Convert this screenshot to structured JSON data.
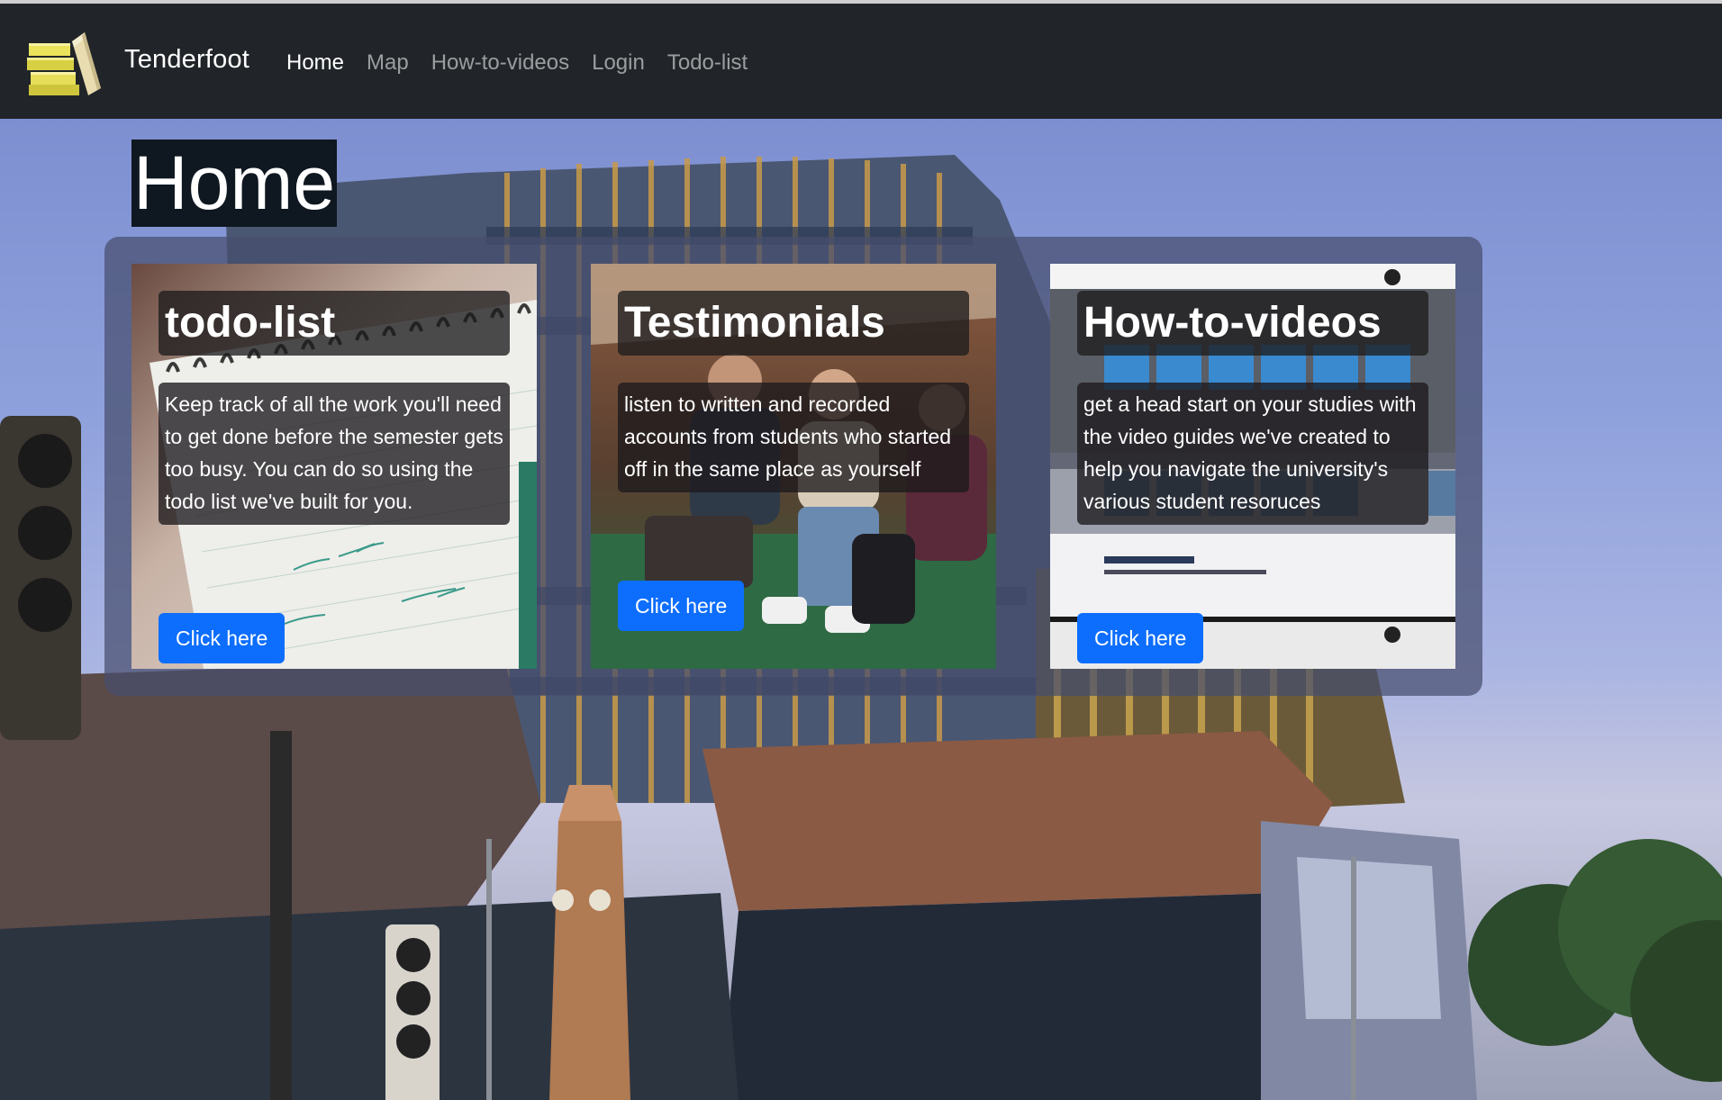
{
  "navbar": {
    "brand": "Tenderfoot",
    "links": [
      {
        "label": "Home",
        "active": true
      },
      {
        "label": "Map",
        "active": false
      },
      {
        "label": "How-to-videos",
        "active": false
      },
      {
        "label": "Login",
        "active": false
      },
      {
        "label": "Todo-list",
        "active": false
      }
    ]
  },
  "page_title": "Home",
  "cards": [
    {
      "title": "todo-list",
      "text": "Keep track of all the work you'll need to get done before the semester gets too busy. You can do so using the todo list we've built for you.",
      "button": "Click here"
    },
    {
      "title": "Testimonials",
      "text": "listen to written and recorded accounts from students who started off in the same place as yourself",
      "button": "Click here"
    },
    {
      "title": "How-to-videos",
      "text": "get a head start on your studies with the video guides we've created to help you navigate the university's various student resoruces",
      "button": "Click here"
    }
  ],
  "colors": {
    "navbar": "#212529",
    "primary_button": "#0d6efd",
    "title_bg": "#0f1720"
  },
  "icons": {
    "brand_logo": "books-icon"
  }
}
